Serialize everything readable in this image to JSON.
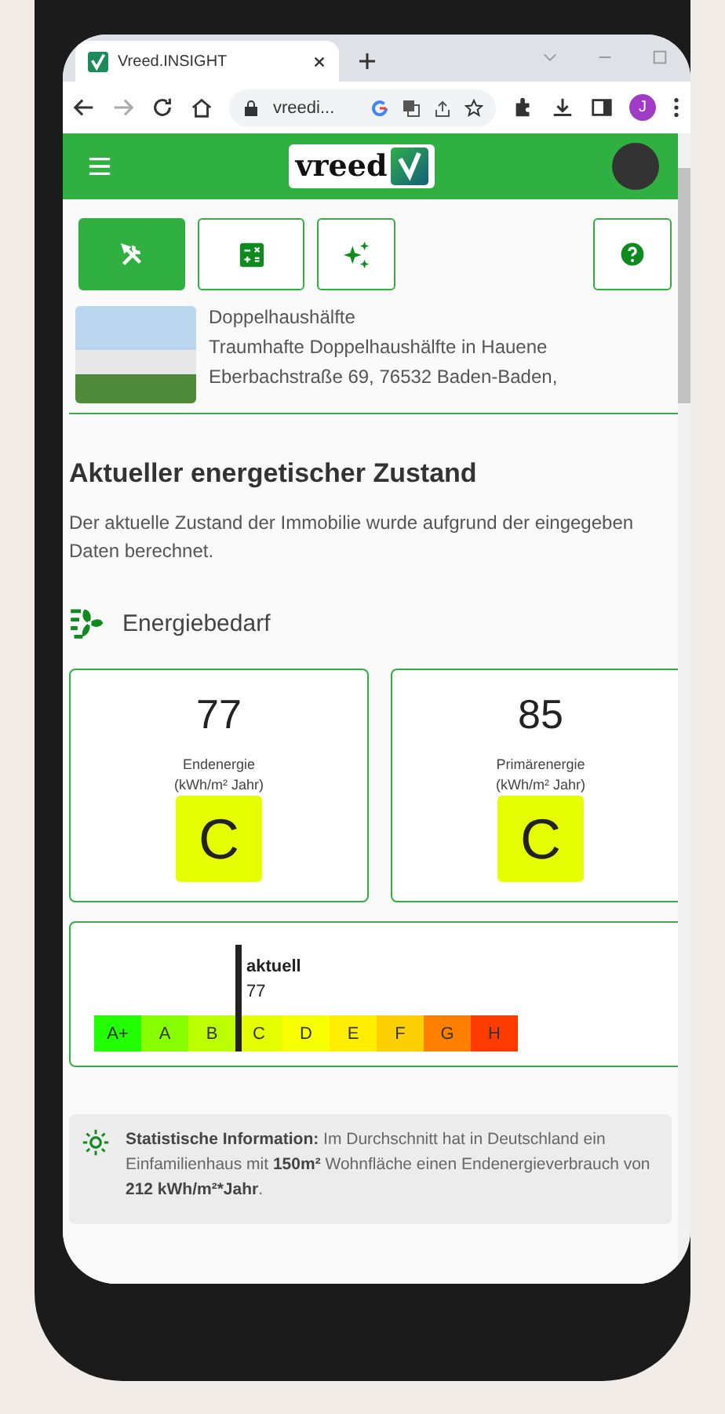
{
  "browser": {
    "tab_title": "Vreed.INSIGHT",
    "url": "vreedi...",
    "profile_initial": "J"
  },
  "header": {
    "logo_text": "vreed"
  },
  "toolbar": [
    {
      "kind": "tools",
      "selected": true
    },
    {
      "kind": "calculator",
      "selected": false
    },
    {
      "kind": "sparkle",
      "selected": false
    },
    {
      "kind": "help",
      "selected": false
    }
  ],
  "property": {
    "type": "Doppelhaushälfte",
    "title": "Traumhafte Doppelhaushälfte in Hauene",
    "address": "Eberbachstraße 69, 76532 Baden-Baden,"
  },
  "section": {
    "heading": "Aktueller energetischer Zustand",
    "description": "Der aktuelle Zustand der Immobilie wurde aufgrund der eingegeben Daten berechnet."
  },
  "energy": {
    "heading": "Energiebedarf",
    "cards": [
      {
        "value": "77",
        "label": "Endenergie",
        "unit": "(kWh/m² Jahr)",
        "class": "C",
        "color": "#e5ff00"
      },
      {
        "value": "85",
        "label": "Primärenergie",
        "unit": "(kWh/m² Jahr)",
        "class": "C",
        "color": "#e5ff00"
      }
    ],
    "scale": {
      "marker_label": "aktuell",
      "marker_value": "77",
      "classes": [
        {
          "label": "A+",
          "color": "#22ff00",
          "selected": false
        },
        {
          "label": "A",
          "color": "#88ff00",
          "selected": false
        },
        {
          "label": "B",
          "color": "#bbff00",
          "selected": false
        },
        {
          "label": "C",
          "color": "#e5ff00",
          "selected": true
        },
        {
          "label": "D",
          "color": "#f7ff00",
          "selected": false
        },
        {
          "label": "E",
          "color": "#ffee00",
          "selected": false
        },
        {
          "label": "F",
          "color": "#ffd000",
          "selected": false
        },
        {
          "label": "G",
          "color": "#ff8000",
          "selected": false
        },
        {
          "label": "H",
          "color": "#ff3c00",
          "selected": false
        }
      ]
    }
  },
  "info": {
    "parts": [
      {
        "text": "Statistische Information:",
        "bold": true
      },
      {
        "text": " Im Durchschnitt hat in Deutschland ein Einfamilienhaus mit ",
        "bold": false
      },
      {
        "text": "150m²",
        "bold": true
      },
      {
        "text": " Wohnfläche einen Endenergieverbrauch von ",
        "bold": false
      },
      {
        "text": "212 kWh/m²*Jahr",
        "bold": true
      },
      {
        "text": ".",
        "bold": false
      }
    ]
  }
}
